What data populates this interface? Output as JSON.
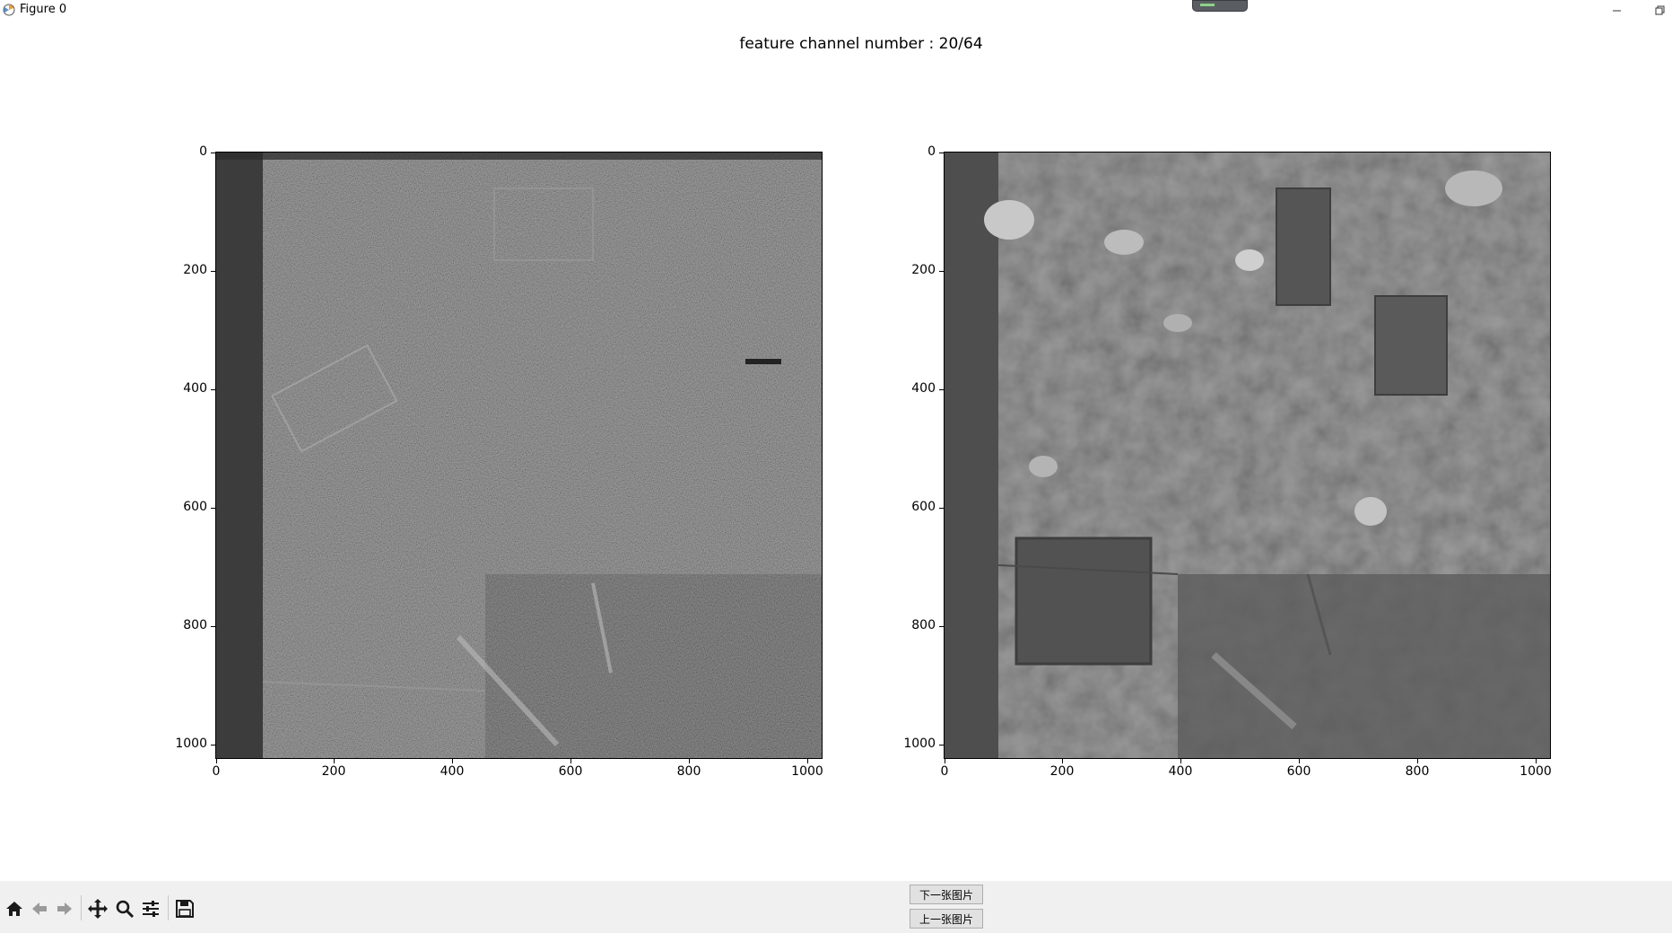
{
  "window": {
    "title": "Figure 0"
  },
  "figure": {
    "title": "feature channel number : 20/64"
  },
  "axes_ticks": {
    "y": [
      "0",
      "200",
      "400",
      "600",
      "800",
      "1000"
    ],
    "x": [
      "0",
      "200",
      "400",
      "600",
      "800",
      "1000"
    ]
  },
  "toolbar": {
    "icons": [
      "home-icon",
      "back-arrow-icon",
      "forward-arrow-icon",
      "pan-move-icon",
      "zoom-magnifier-icon",
      "configure-subplots-icon",
      "save-icon"
    ]
  },
  "buttons": {
    "next_image": "下一张图片",
    "prev_image": "上一张图片"
  }
}
